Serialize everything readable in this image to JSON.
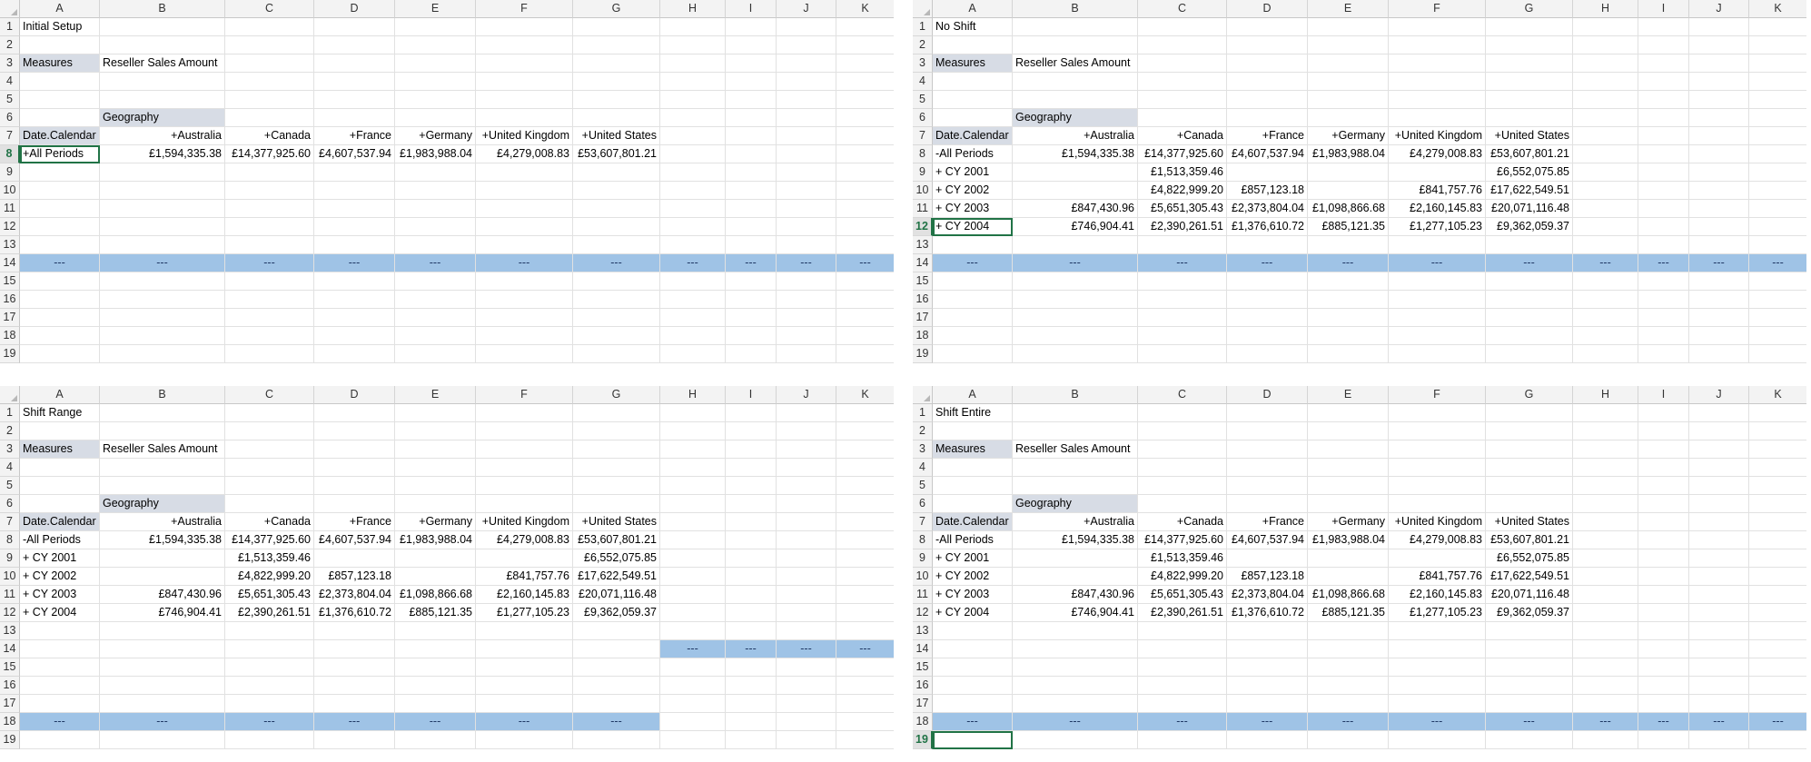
{
  "columns": [
    "A",
    "B",
    "C",
    "D",
    "E",
    "F",
    "G",
    "H",
    "I",
    "J",
    "K"
  ],
  "row_numbers": [
    "1",
    "2",
    "3",
    "4",
    "5",
    "6",
    "7",
    "8",
    "9",
    "10",
    "11",
    "12",
    "13",
    "14",
    "15",
    "16",
    "17",
    "18",
    "19"
  ],
  "labels": {
    "measures": "Measures",
    "measure_value": "Reseller Sales Amount",
    "geography": "Geography",
    "row_field": "Date.Calendar",
    "countries": [
      "+Australia",
      "+Canada",
      "+France",
      "+Germany",
      "+United Kingdom",
      "+United States"
    ],
    "separator": "---"
  },
  "all_periods_collapsed": "+All Periods",
  "all_periods_expanded": "-All Periods",
  "totals": [
    "£1,594,335.38",
    "£14,377,925.60",
    "£4,607,537.94",
    "£1,983,988.04",
    "£4,279,008.83",
    "£53,607,801.21"
  ],
  "years": [
    {
      "label": "+   CY 2001",
      "values": [
        "",
        "£1,513,359.46",
        "",
        "",
        "",
        "£6,552,075.85"
      ]
    },
    {
      "label": "+   CY 2002",
      "values": [
        "",
        "£4,822,999.20",
        "£857,123.18",
        "",
        "£841,757.76",
        "£17,622,549.51"
      ]
    },
    {
      "label": "+   CY 2003",
      "values": [
        "£847,430.96",
        "£5,651,305.43",
        "£2,373,804.04",
        "£1,098,866.68",
        "£2,160,145.83",
        "£20,071,116.48"
      ]
    },
    {
      "label": "+   CY 2004",
      "values": [
        "£746,904.41",
        "£2,390,261.51",
        "£1,376,610.72",
        "£885,121.35",
        "£1,277,105.23",
        "£9,362,059.37"
      ]
    }
  ],
  "sheets": [
    {
      "title": "Initial Setup",
      "expanded": false,
      "active_row": 8
    },
    {
      "title": "No Shift",
      "expanded": true,
      "active_row": 12
    },
    {
      "title": "Shift Range",
      "expanded": true,
      "active_row": 0
    },
    {
      "title": "Shift Entire",
      "expanded": true,
      "active_row": 19
    }
  ]
}
